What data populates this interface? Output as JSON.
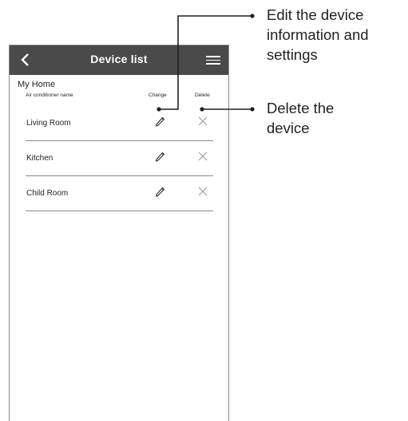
{
  "header": {
    "title": "Device list"
  },
  "home": {
    "name": "My Home"
  },
  "columns": {
    "name": "Air conditioner name",
    "change": "Change",
    "delete": "Delete"
  },
  "devices": [
    {
      "name": "Living Room"
    },
    {
      "name": "Kitchen"
    },
    {
      "name": "Child Room"
    }
  ],
  "callouts": {
    "edit": [
      "Edit the device",
      "information and",
      "settings"
    ],
    "delete": [
      "Delete the",
      "device"
    ]
  }
}
